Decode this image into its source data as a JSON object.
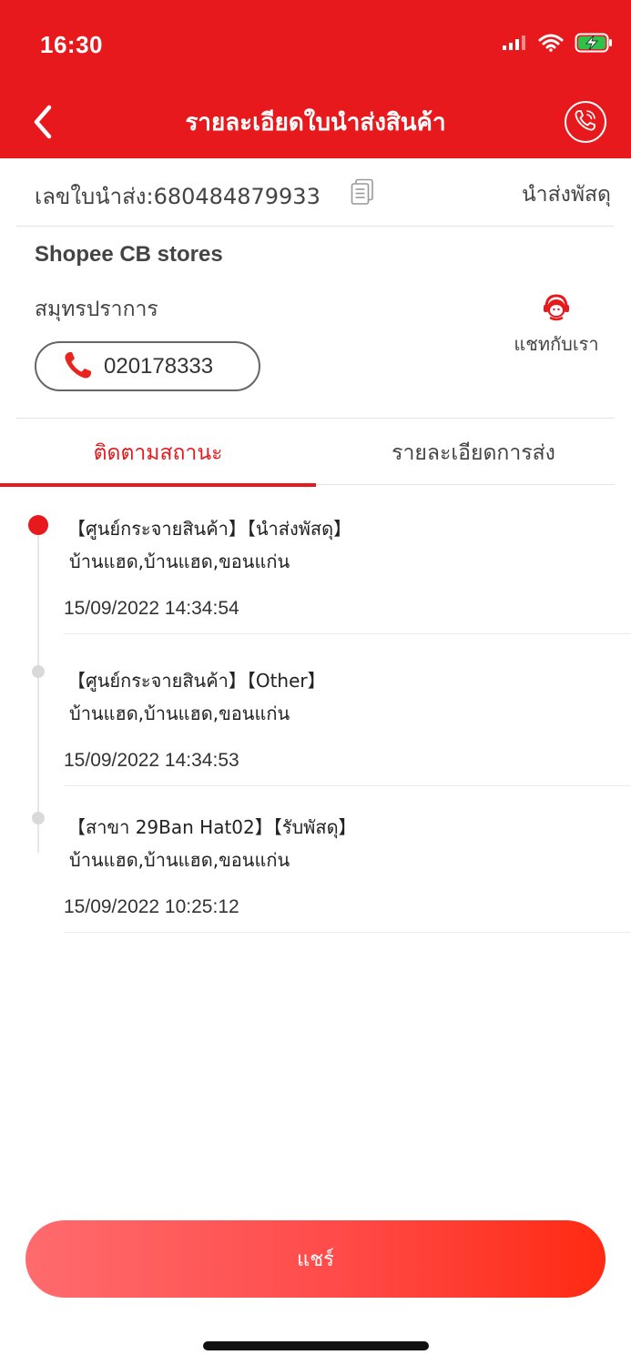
{
  "status_bar": {
    "time": "16:30",
    "icons": [
      "signal-icon",
      "wifi-icon",
      "battery-charging-icon"
    ]
  },
  "header": {
    "title": "รายละเอียดใบนำส่งสินค้า",
    "back_icon": "chevron-left-icon",
    "call_icon": "phone-call-icon",
    "background": "#e8191d"
  },
  "waybill": {
    "label": "เลขใบนำส่ง:680484879933",
    "status": "นำส่งพัสดุ",
    "copy_icon": "copy-icon"
  },
  "store": {
    "name": "Shopee CB stores",
    "region": "สมุทรปราการ",
    "phone": "020178333",
    "chat_label": "แชทกับเรา"
  },
  "tabs": [
    {
      "label": "ติดตามสถานะ",
      "active": true
    },
    {
      "label": "รายละเอียดการส่ง",
      "active": false
    }
  ],
  "timeline": [
    {
      "title": "【ศูนย์กระจายสินค้า】【นำส่งพัสดุ】",
      "address": "บ้านแฮด,บ้านแฮด,ขอนแก่น",
      "time": "15/09/2022 14:34:54"
    },
    {
      "title": "【ศูนย์กระจายสินค้า】【Other】",
      "address": "บ้านแฮด,บ้านแฮด,ขอนแก่น",
      "time": "15/09/2022 14:34:53"
    },
    {
      "title": "【สาขา 29Ban Hat02】【รับพัสดุ】",
      "address": "บ้านแฮด,บ้านแฮด,ขอนแก่น",
      "time": "15/09/2022 10:25:12"
    }
  ],
  "share_label": "แชร์",
  "colors": {
    "accent": "#e8191d",
    "dot_inactive": "#d9d9d9",
    "battery": "#2ec24a"
  }
}
